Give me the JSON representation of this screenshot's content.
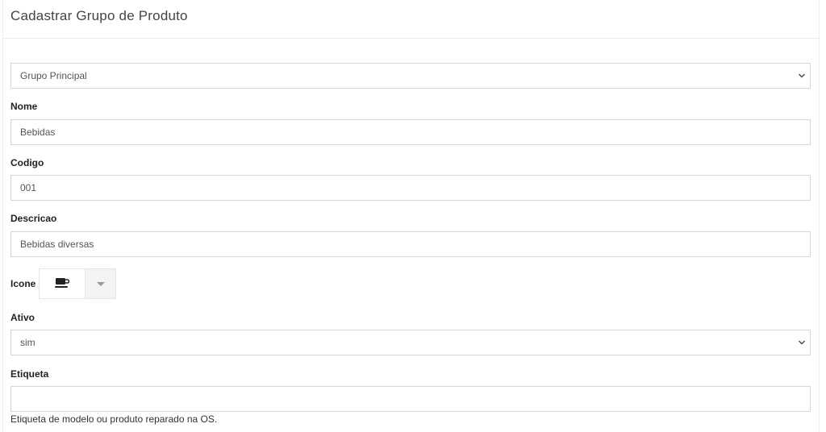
{
  "page": {
    "title": "Cadastrar Grupo de Produto"
  },
  "form": {
    "grupo": {
      "value": "Grupo Principal"
    },
    "nome": {
      "label": "Nome",
      "value": "Bebidas"
    },
    "codigo": {
      "label": "Codigo",
      "value": "001"
    },
    "descricao": {
      "label": "Descricao",
      "value": "Bebidas diversas"
    },
    "icone": {
      "label": "Icone",
      "selected_icon": "coffee-cup-icon"
    },
    "ativo": {
      "label": "Ativo",
      "value": "sim"
    },
    "etiqueta": {
      "label": "Etiqueta",
      "value": "",
      "help": "Etiqueta de modelo ou produto reparado na OS."
    }
  }
}
